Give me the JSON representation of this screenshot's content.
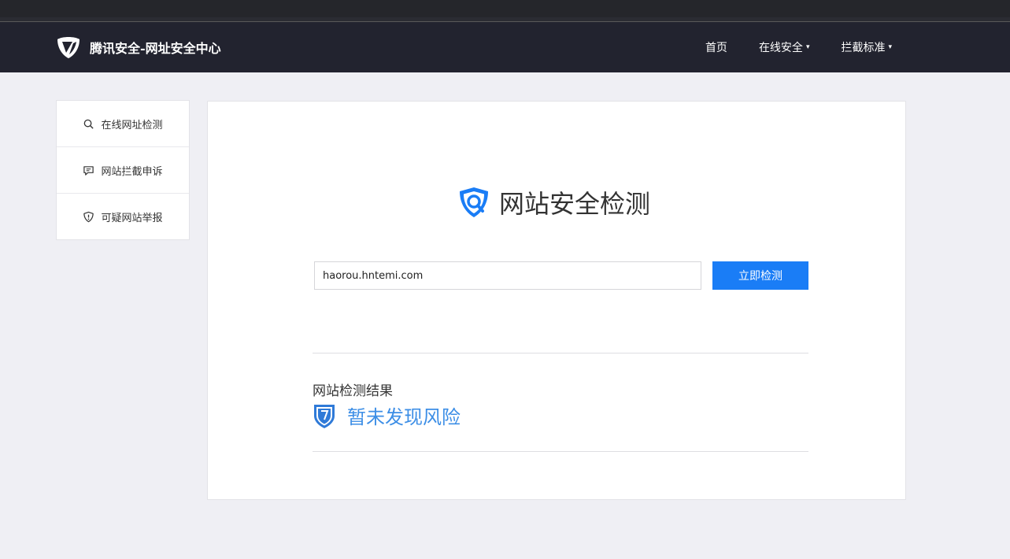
{
  "header": {
    "brand_title": "腾讯安全-网址安全中心",
    "nav": [
      {
        "label": "首页",
        "has_caret": false
      },
      {
        "label": "在线安全",
        "has_caret": true
      },
      {
        "label": "拦截标准",
        "has_caret": true
      }
    ],
    "caret_glyph": "▾"
  },
  "sidebar": {
    "items": [
      {
        "label": "在线网址检测",
        "icon": "search-icon"
      },
      {
        "label": "网站拦截申诉",
        "icon": "comment-icon"
      },
      {
        "label": "可疑网站举报",
        "icon": "shield-alert-icon"
      }
    ]
  },
  "main": {
    "title": "网站安全检测",
    "url_input": {
      "value": "haorou.hntemi.com",
      "placeholder": ""
    },
    "check_button": "立即检测",
    "result_label": "网站检测结果",
    "result_status": "暂未发现风险"
  },
  "colors": {
    "header_bg": "#22232f",
    "accent_blue": "#1a7df6",
    "result_blue": "#3c8ee6",
    "page_bg": "#efeff4"
  }
}
